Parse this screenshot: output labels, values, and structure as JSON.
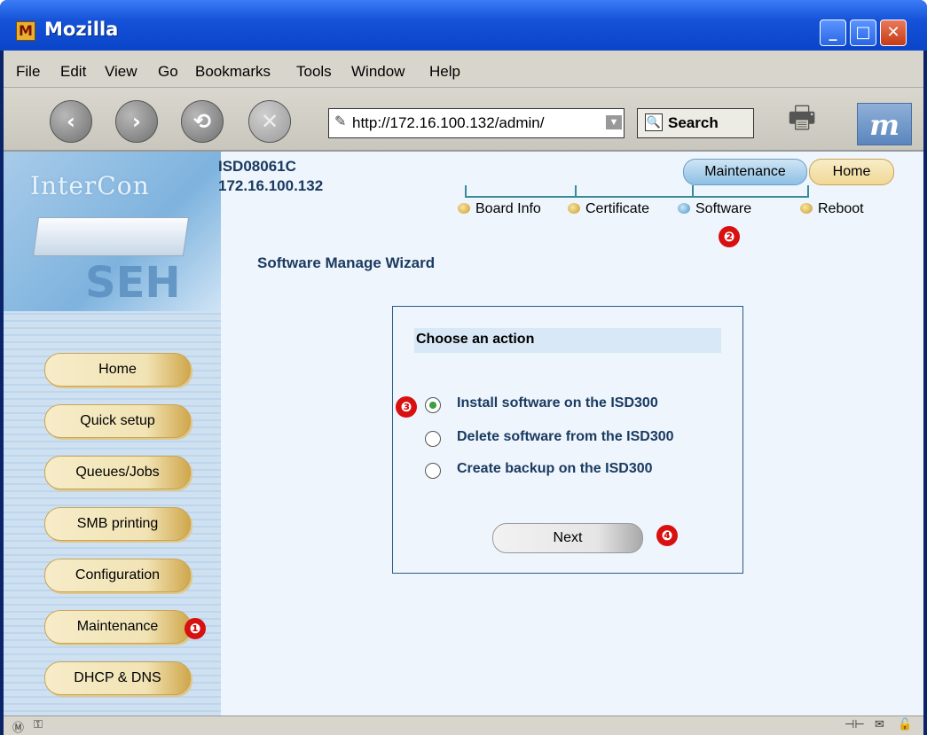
{
  "window": {
    "title": "Mozilla"
  },
  "window_controls": {
    "minimize": "_",
    "maximize": "□",
    "close": "✕"
  },
  "menu": [
    "File",
    "Edit",
    "View",
    "Go",
    "Bookmarks",
    "Tools",
    "Window",
    "Help"
  ],
  "navigation": {
    "back_glyph": "‹",
    "forward_glyph": "›",
    "reload_glyph": "⟲",
    "stop_glyph": "✕",
    "url": "http://172.16.100.132/admin/",
    "search_label": "Search"
  },
  "device": {
    "name": "ISD08061C",
    "ip": "172.16.100.132"
  },
  "logo": {
    "brand": "InterCon",
    "mark": "SEH"
  },
  "tabs": {
    "maintenance": "Maintenance",
    "home": "Home"
  },
  "subnav": {
    "board_info": "Board Info",
    "certificate": "Certificate",
    "software": "Software",
    "reboot": "Reboot"
  },
  "sidebar": {
    "items": [
      "Home",
      "Quick setup",
      "Queues/Jobs",
      "SMB printing",
      "Configuration",
      "Maintenance",
      "DHCP & DNS"
    ]
  },
  "wizard": {
    "title": "Software Manage Wizard",
    "panel_heading": "Choose an action",
    "options": [
      {
        "label": "Install software on the ISD300",
        "selected": true
      },
      {
        "label": "Delete software from the ISD300",
        "selected": false
      },
      {
        "label": "Create backup on the ISD300",
        "selected": false
      }
    ],
    "next_label": "Next"
  },
  "markers": [
    "❶",
    "❷",
    "❸",
    "❹"
  ],
  "icons": {
    "app": "mozilla-icon",
    "print": "print-icon",
    "logo": "m-logo-icon"
  },
  "colors": {
    "titlebar": "#1552d8",
    "content_bg": "#eef5fc",
    "heading": "#1a3a60",
    "marker": "#d81010",
    "selected_radio": "#3aa040"
  }
}
